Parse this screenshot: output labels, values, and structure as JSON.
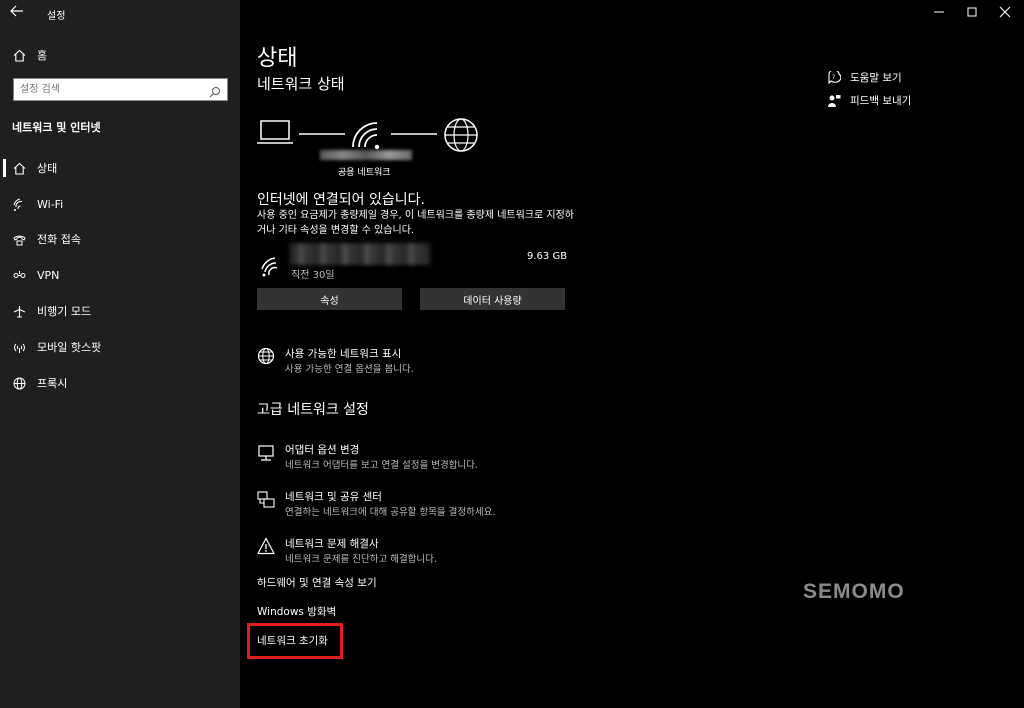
{
  "window": {
    "title": "설정"
  },
  "sidebar": {
    "home_label": "홈",
    "search_placeholder": "설정 검색",
    "section_title": "네트워크 및 인터넷",
    "items": [
      {
        "label": "상태",
        "icon": "home-status-icon",
        "selected": true
      },
      {
        "label": "Wi-Fi",
        "icon": "wifi-icon"
      },
      {
        "label": "전화 접속",
        "icon": "dialup-icon"
      },
      {
        "label": "VPN",
        "icon": "vpn-icon"
      },
      {
        "label": "비행기 모드",
        "icon": "airplane-icon"
      },
      {
        "label": "모바일 핫스팟",
        "icon": "hotspot-icon"
      },
      {
        "label": "프록시",
        "icon": "globe-icon"
      }
    ]
  },
  "main": {
    "title": "상태",
    "network_status_heading": "네트워크 상태",
    "network_kind": "공용 네트워크",
    "connection_title": "인터넷에 연결되어 있습니다.",
    "connection_desc": "사용 중인 요금제가 종량제일 경우, 이 네트워크를 종량제 네트워크로 지정하거나 기타 속성을 변경할 수 있습니다.",
    "usage": {
      "time": "직전 30일",
      "size": "9.63 GB"
    },
    "buttons": {
      "properties": "속성",
      "data_usage": "데이터 사용량"
    },
    "show_networks": {
      "title": "사용 가능한 네트워크 표시",
      "desc": "사용 가능한 연결 옵션을 봅니다."
    },
    "advanced_heading": "고급 네트워크 설정",
    "adapter": {
      "title": "어댑터 옵션 변경",
      "desc": "네트워크 어댑터를 보고 연결 설정을 변경합니다."
    },
    "sharing_center": {
      "title": "네트워크 및 공유 센터",
      "desc": "연결하는 네트워크에 대해 공유할 항목을 결정하세요."
    },
    "troubleshooter": {
      "title": "네트워크 문제 해결사",
      "desc": "네트워크 문제를 진단하고 해결합니다."
    },
    "hw_props": "하드웨어 및 연결 속성 보기",
    "firewall": "Windows 방화벽",
    "reset": "네트워크 초기화"
  },
  "right": {
    "help": "도움말 보기",
    "feedback": "피드백 보내기"
  },
  "watermark": "SEMOMO",
  "colors": {
    "highlight_border": "#e31b23",
    "sidebar_bg": "#1f1f1f",
    "button_bg": "#333333"
  }
}
